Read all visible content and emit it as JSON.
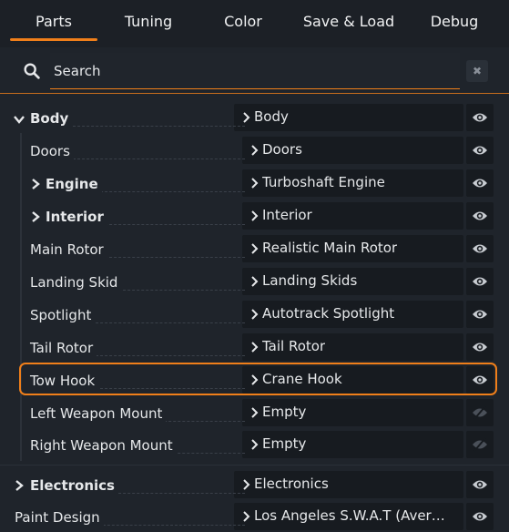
{
  "tabs": [
    {
      "label": "Parts"
    },
    {
      "label": "Tuning"
    },
    {
      "label": "Color"
    },
    {
      "label": "Save & Load"
    },
    {
      "label": "Debug"
    }
  ],
  "search": {
    "placeholder": "Search",
    "clear_label": "✖"
  },
  "rows": [
    {
      "label": "Body",
      "value": "Body"
    },
    {
      "label": "Doors",
      "value": "Doors"
    },
    {
      "label": "Engine",
      "value": "Turboshaft Engine"
    },
    {
      "label": "Interior",
      "value": "Interior"
    },
    {
      "label": "Main Rotor",
      "value": "Realistic Main Rotor"
    },
    {
      "label": "Landing Skid",
      "value": "Landing Skids"
    },
    {
      "label": "Spotlight",
      "value": "Autotrack Spotlight"
    },
    {
      "label": "Tail Rotor",
      "value": "Tail Rotor"
    },
    {
      "label": "Tow Hook",
      "value": "Crane Hook"
    },
    {
      "label": "Left Weapon Mount",
      "value": "Empty"
    },
    {
      "label": "Right Weapon Mount",
      "value": "Empty"
    },
    {
      "label": "Electronics",
      "value": "Electronics"
    },
    {
      "label": "Paint Design",
      "value": "Los Angeles S.W.A.T (Avera..."
    }
  ],
  "colors": {
    "accent": "#f07f1a",
    "background": "#1f242b",
    "field": "#171b20"
  }
}
